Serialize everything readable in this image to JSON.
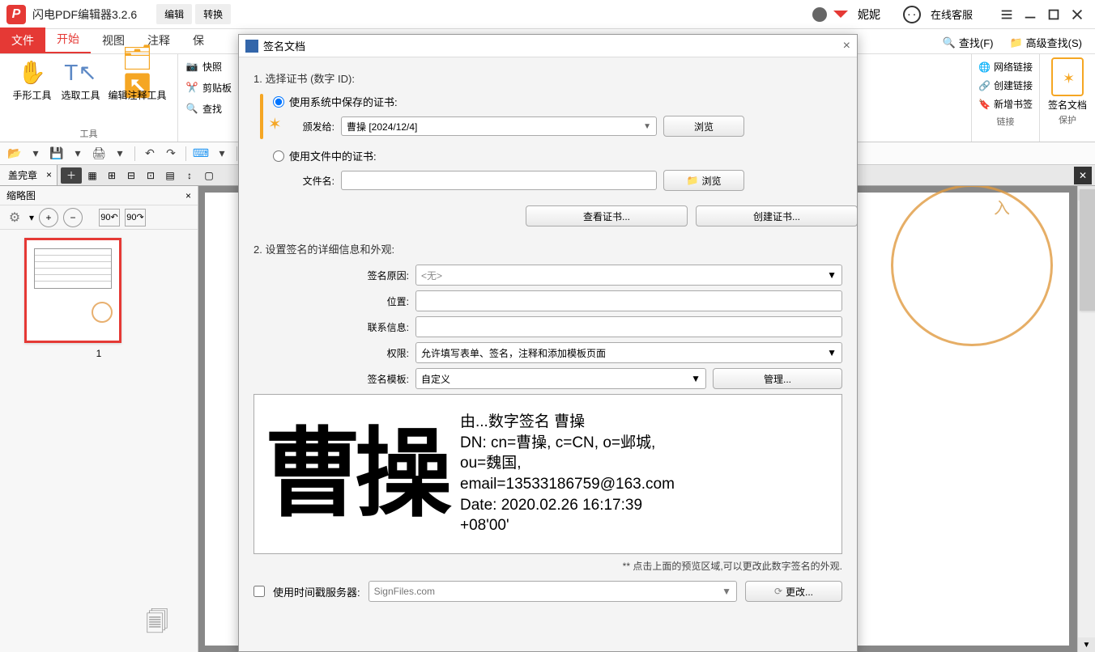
{
  "app": {
    "title": "闪电PDF编辑器3.2.6"
  },
  "titlebar_menu": {
    "edit": "编辑",
    "convert": "转换"
  },
  "user": {
    "name": "妮妮",
    "support": "在线客服"
  },
  "ribbon_tabs": {
    "file": "文件",
    "start": "开始",
    "view": "视图",
    "annotate": "注释",
    "insert": "保"
  },
  "find": {
    "find": "查找(F)",
    "adv_find": "高级查找(S)"
  },
  "tools": {
    "hand": "手形工具",
    "select": "选取工具",
    "edit_annot": "编辑注释工具",
    "snapshot": "快照",
    "clipboard": "剪贴板",
    "search": "查找",
    "tools_label": "工具"
  },
  "links_group": {
    "web": "网络链接",
    "create": "创建链接",
    "bookmark": "新增书签",
    "label": "链接"
  },
  "protect_group": {
    "sign": "签名文档",
    "label": "保护"
  },
  "doc_tab": {
    "name": "盖完章"
  },
  "side": {
    "title": "缩略图",
    "page_num": "1",
    "rotL": "90",
    "rotR": "90"
  },
  "dialog": {
    "title": "签名文档",
    "step1": "1. 选择证书 (数字 ID):",
    "radio_system": "使用系统中保存的证书:",
    "issued_to": "颁发给:",
    "issued_value": "曹操 [2024/12/4]",
    "browse": "浏览",
    "radio_file": "使用文件中的证书:",
    "filename": "文件名:",
    "view_cert": "查看证书...",
    "create_cert": "创建证书...",
    "step2": "2. 设置签名的详细信息和外观:",
    "reason": "签名原因:",
    "reason_value": "<无>",
    "location": "位置:",
    "contact": "联系信息:",
    "perm": "权限:",
    "perm_value": "允许填写表单、签名，注释和添加模板页面",
    "template": "签名模板:",
    "template_value": "自定义",
    "manage": "管理...",
    "signer_name": "曹操",
    "info_line1": "由...数字签名 曹操",
    "info_line2": "DN: cn=曹操, c=CN, o=邺城,",
    "info_line3": "ou=魏国,",
    "info_line4": "email=13533186759@163.com",
    "info_line5": "Date: 2020.02.26 16:17:39",
    "info_line6": "+08'00'",
    "hint": "** 点击上面的预览区域,可以更改此数字签名的外观.",
    "use_ts": "使用时间戳服务器:",
    "ts_value": "SignFiles.com",
    "more": "更改..."
  }
}
